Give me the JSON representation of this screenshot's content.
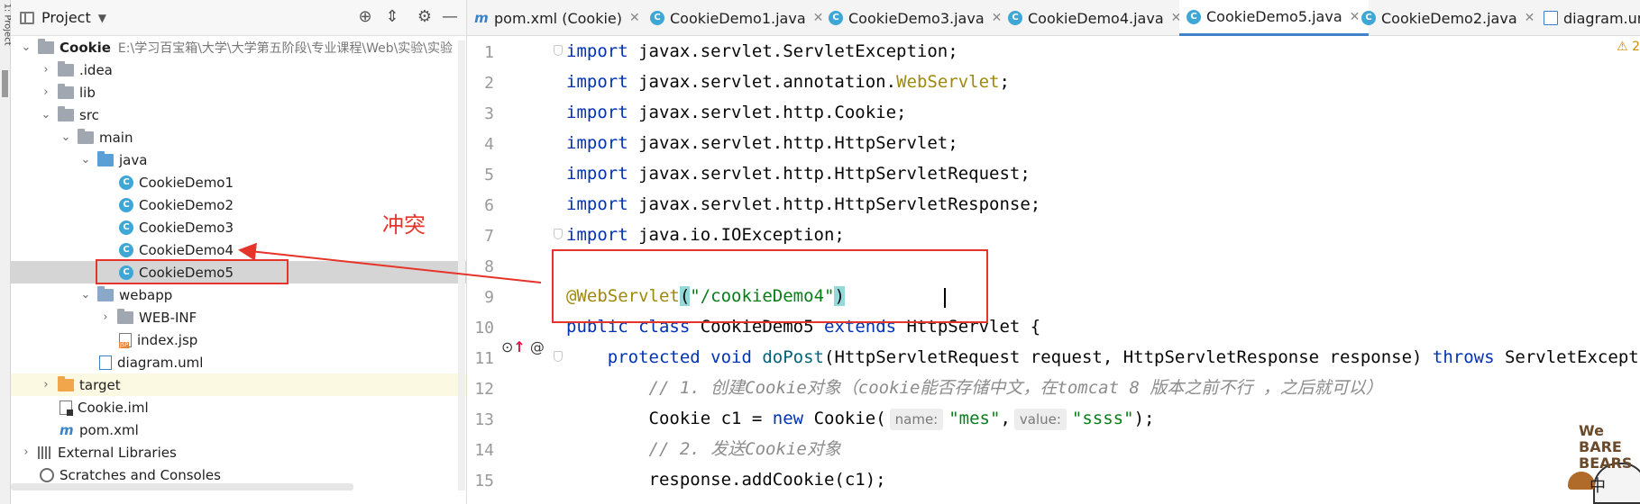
{
  "toolstrip": {
    "label": "1: Project"
  },
  "project_panel": {
    "title": "Project",
    "tree": [
      {
        "label": "Cookie",
        "path": "E:\\学习百宝箱\\大学\\大学第五阶段\\专业课程\\Web\\实验\\实验"
      },
      {
        "label": ".idea"
      },
      {
        "label": "lib"
      },
      {
        "label": "src"
      },
      {
        "label": "main"
      },
      {
        "label": "java"
      },
      {
        "label": "CookieDemo1"
      },
      {
        "label": "CookieDemo2"
      },
      {
        "label": "CookieDemo3"
      },
      {
        "label": "CookieDemo4"
      },
      {
        "label": "CookieDemo5"
      },
      {
        "label": "webapp"
      },
      {
        "label": "WEB-INF"
      },
      {
        "label": "index.jsp"
      },
      {
        "label": "diagram.uml"
      },
      {
        "label": "target"
      },
      {
        "label": "Cookie.iml"
      },
      {
        "label": "pom.xml"
      },
      {
        "label": "External Libraries"
      },
      {
        "label": "Scratches and Consoles"
      }
    ]
  },
  "annotation": {
    "label": "冲突"
  },
  "tabs": [
    {
      "label": "pom.xml (Cookie)"
    },
    {
      "label": "CookieDemo1.java"
    },
    {
      "label": "CookieDemo3.java"
    },
    {
      "label": "CookieDemo4.java"
    },
    {
      "label": "CookieDemo5.java"
    },
    {
      "label": "CookieDemo2.java"
    },
    {
      "label": "diagram.uml"
    }
  ],
  "editor": {
    "warning_count": "2",
    "line_numbers": [
      "1",
      "2",
      "3",
      "4",
      "5",
      "6",
      "7",
      "8",
      "9",
      "10",
      "11",
      "12",
      "13",
      "14",
      "15"
    ],
    "code": {
      "l1": {
        "kw": "import",
        "rest": " javax.servlet.ServletException;"
      },
      "l2": {
        "kw": "import",
        "rest": " javax.servlet.annotation.",
        "ann": "WebServlet",
        "end": ";"
      },
      "l3": {
        "kw": "import",
        "rest": " javax.servlet.http.Cookie;"
      },
      "l4": {
        "kw": "import",
        "rest": " javax.servlet.http.HttpServlet;"
      },
      "l5": {
        "kw": "import",
        "rest": " javax.servlet.http.HttpServletRequest;"
      },
      "l6": {
        "kw": "import",
        "rest": " javax.servlet.http.HttpServletResponse;"
      },
      "l7": {
        "kw": "import",
        "rest": " java.io.IOException;"
      },
      "l9": {
        "ann": "@WebServlet",
        "open": "(",
        "str": "\"/cookieDemo4\"",
        "close": ")"
      },
      "l10": {
        "kw1": "public class",
        "name": " CookieDemo5 ",
        "kw2": "extends",
        "rest": " HttpServlet {"
      },
      "l11": {
        "indent": "    ",
        "kw": "protected void",
        "name": " doPost",
        "params": "(HttpServletRequest request, HttpServletResponse response) ",
        "kw2": "throws",
        "rest": " ServletException"
      },
      "l12": {
        "indent": "        ",
        "comment": "// 1. 创建Cookie对象（cookie能否存储中文，在tomcat 8 版本之前不行 ，之后就可以）"
      },
      "l13": {
        "indent": "        ",
        "pre": "Cookie c1 = ",
        "kw": "new",
        "mid": " Cookie(",
        "hint1": "name:",
        "s1": "\"mes\"",
        "comma": ",",
        "hint2": "value:",
        "s2": "\"ssss\"",
        "end": ");"
      },
      "l14": {
        "indent": "        ",
        "comment": "// 2. 发送Cookie对象"
      },
      "l15": {
        "indent": "        ",
        "text": "response.addCookie(c1);"
      }
    }
  },
  "logo": {
    "text": "WE BARE BEARS",
    "zh": "中"
  }
}
